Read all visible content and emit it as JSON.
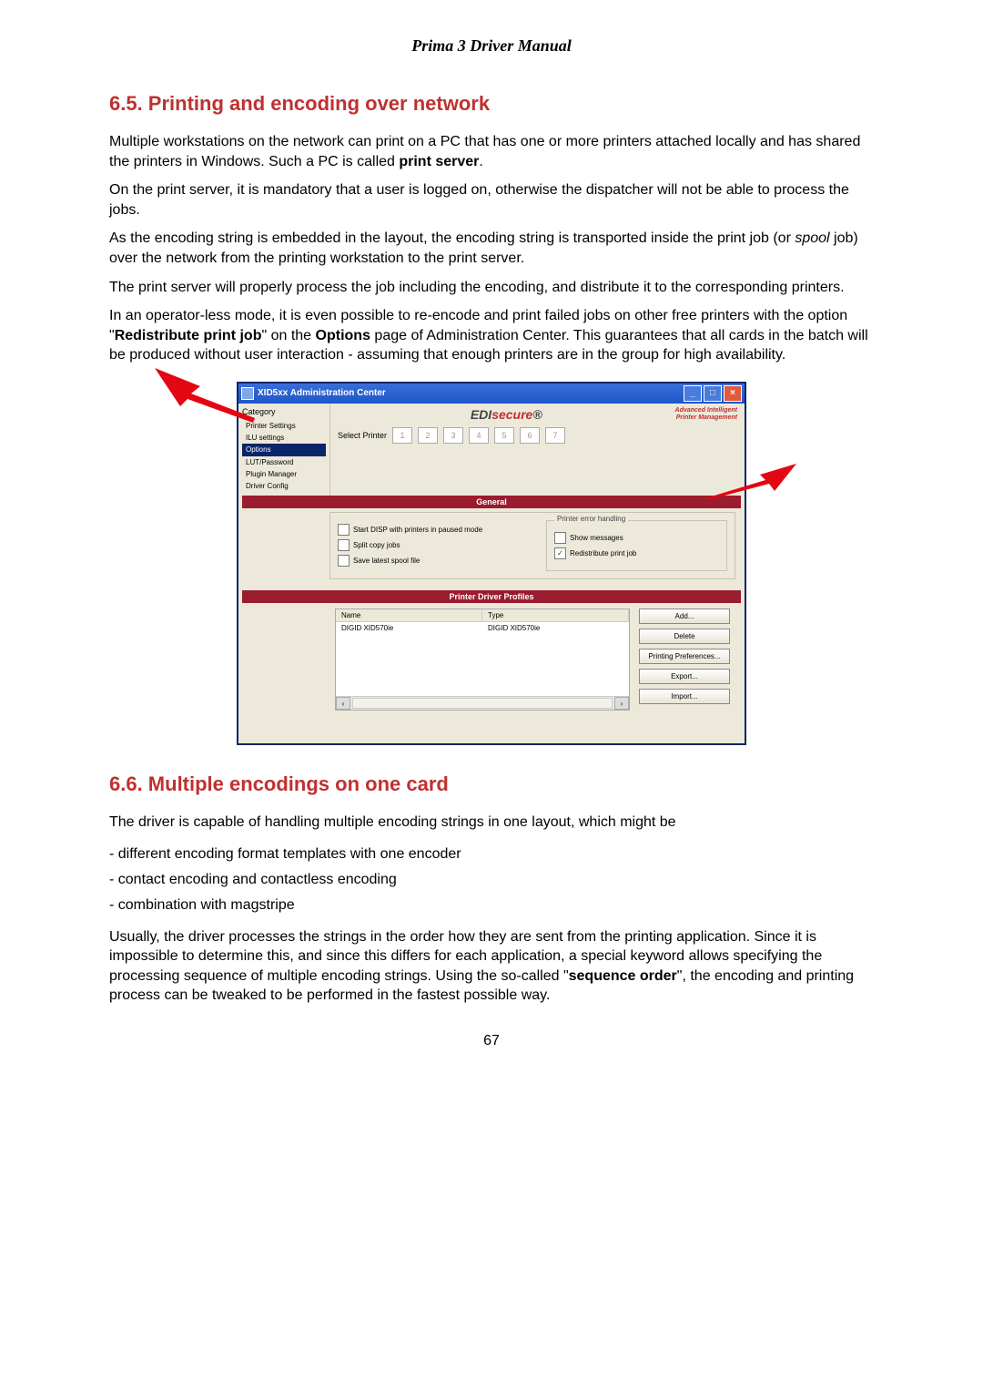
{
  "doc_title": "Prima 3 Driver Manual",
  "page_number": "67",
  "section_65": {
    "heading": "6.5.   Printing and encoding over network",
    "p1_a": "Multiple workstations on the network can print on a PC that has one or more printers attached locally and has shared the printers in Windows. Such a PC is called ",
    "p1_b_bold": "print server",
    "p1_c": ".",
    "p2": "On the print server, it is mandatory that a user is logged on, otherwise the dispatcher will not be able to process the jobs.",
    "p3_a": "As the encoding string is embedded in the layout, the encoding string is transported inside the print job (or ",
    "p3_b_ital": "spool",
    "p3_c": " job) over the network from the printing workstation to the print server.",
    "p4": "The print server will properly process the job including the encoding, and distribute it to the corresponding printers.",
    "p5_a": "In an operator-less mode, it is even possible to re-encode and print failed jobs on other free printers with the option \"",
    "p5_b_bold": "Redistribute print job",
    "p5_c": "\" on the ",
    "p5_d_bold": "Options",
    "p5_e": " page of Administration Center. This guarantees that all cards in the batch will be produced without user interaction - assuming that enough printers are in the group for high availability."
  },
  "screenshot": {
    "window_title": "XID5xx Administration Center",
    "brand_prefix": "EDI",
    "brand_main": "secure",
    "brand_reg": "®",
    "brand_sub_l1": "Advanced Intelligent",
    "brand_sub_l2": "Printer Management",
    "category_label": "Category",
    "sidebar": [
      "Printer Settings",
      "ILU settings",
      "Options",
      "LUT/Password",
      "Plugin Manager",
      "Driver Config"
    ],
    "select_printer_label": "Select Printer",
    "printer_nums": [
      "1",
      "2",
      "3",
      "4",
      "5",
      "6",
      "7"
    ],
    "tab_general": "General",
    "chk_start_disp": "Start DISP with printers in paused mode",
    "chk_split": "Split copy jobs",
    "chk_save_spool": "Save latest spool file",
    "peh_legend": "Printer error handling",
    "chk_show_msgs": "Show messages",
    "chk_redist": "Redistribute print job",
    "tab_profiles": "Printer Driver Profiles",
    "col_name": "Name",
    "col_type": "Type",
    "row_name": "DIGID XID570ie",
    "row_type": "DIGID XID570ie",
    "btn_add": "Add...",
    "btn_delete": "Delete",
    "btn_prefs": "Printing Preferences...",
    "btn_export": "Export...",
    "btn_import": "Import..."
  },
  "section_66": {
    "heading": "6.6.   Multiple encodings on one card",
    "intro": "The driver is capable of handling multiple encoding strings in one layout, which might be",
    "bullets": [
      "different encoding format templates with one encoder",
      "contact encoding and contactless encoding",
      "combination with magstripe"
    ],
    "p_a": "Usually, the driver processes the strings in the order how they are sent from the printing application. Since it is impossible to determine this, and since this differs for each application, a special keyword allows specifying the processing sequence of multiple encoding strings. Using the so-called \"",
    "p_b_bold": "sequence order",
    "p_c": "\", the encoding and printing process can be tweaked to be performed in the fastest possible way."
  }
}
